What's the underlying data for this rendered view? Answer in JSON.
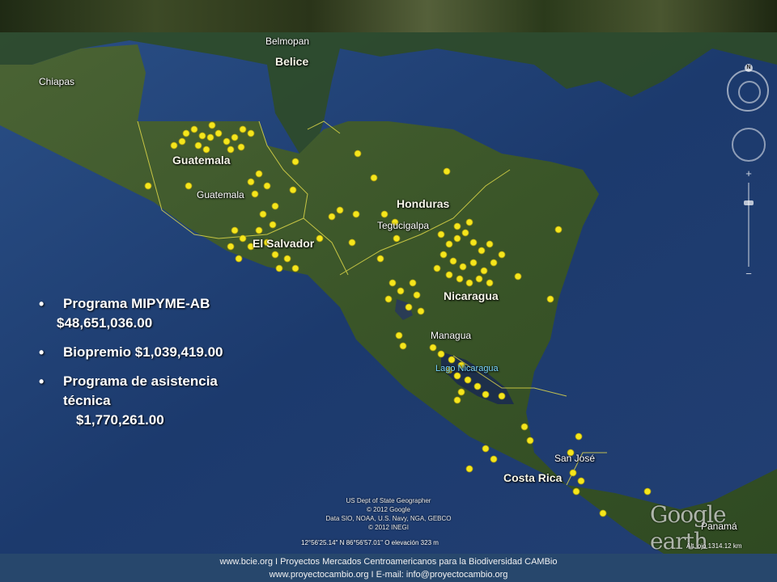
{
  "map": {
    "cities": [
      {
        "name": "Belmopan"
      },
      {
        "name": "Chiapas"
      },
      {
        "name": "Guatemala"
      },
      {
        "name": "Tegucigalpa"
      },
      {
        "name": "Managua"
      },
      {
        "name": "San José"
      }
    ],
    "countries": [
      {
        "name": "Belice"
      },
      {
        "name": "Guatemala"
      },
      {
        "name": "Honduras"
      },
      {
        "name": "El Salvador"
      },
      {
        "name": "Nicaragua"
      },
      {
        "name": "Costa Rica"
      },
      {
        "name": "Panamá"
      }
    ],
    "lake": "Lago Nicaragua",
    "credits": [
      "US Dept of State Geographer",
      "© 2012 Google",
      "Data SIO, NOAA, U.S. Navy, NGA, GEBCO",
      "© 2012 INEGI"
    ],
    "coordinates": "12°56'25.14\" N   86°56'57.01\" O  elevación   323 m",
    "eye_altitude": "Alt. ojo  1314.12 km",
    "logo": "Google earth",
    "compass_letter": "N",
    "colors": {
      "ocean": "#1e3d72",
      "land": "#3d5a2a",
      "pins": "#f5e61c",
      "footer": "#27476c"
    }
  },
  "bullets": [
    {
      "title": "Programa MIPYME-AB",
      "amount": "$48,651,036.00"
    },
    {
      "title": "Biopremio $1,039,419.00",
      "amount": ""
    },
    {
      "title": "Programa de asistencia técnica",
      "amount": "$1,770,261.00"
    }
  ],
  "footer": {
    "line1": "www.bcie.org I Proyectos Mercados Centroamericanos para la Biodiversidad CAMBio",
    "line2": "www.proyectocambio.org  I E-mail: info@proyectocambio.org"
  }
}
